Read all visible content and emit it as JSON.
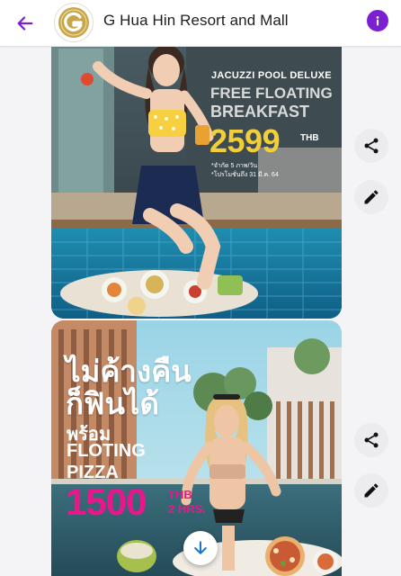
{
  "header": {
    "title": "G Hua Hin Resort and Mall",
    "logo_letter": "G"
  },
  "posts": [
    {
      "kicker": "JACUZZI POOL DELUXE",
      "headline_1": "FREE FLOATING",
      "headline_2": "BREAKFAST",
      "price": "2599",
      "currency": "THB",
      "note_1": "*จำกัด 5 ภาพ/วัน",
      "note_2": "*โปรโมชั่นถึง 31 มี.ค. 64"
    },
    {
      "line_1": "ไม่ค้างคืน",
      "line_2": "ก็ฟินได้",
      "line_3": "พร้อม",
      "line_4": "FLOTING",
      "line_5": "PIZZA",
      "price": "1500",
      "currency": "THB",
      "duration": "2 HRS."
    }
  ],
  "icons": {
    "back": "arrow-left-icon",
    "info": "info-icon",
    "share": "share-icon",
    "edit": "pencil-icon",
    "scroll_down": "arrow-down-icon"
  },
  "colors": {
    "accent": "#7b1fd1",
    "gold": "#c8a64c",
    "price_yellow": "#f2cf38",
    "price_pink": "#e8188c"
  }
}
